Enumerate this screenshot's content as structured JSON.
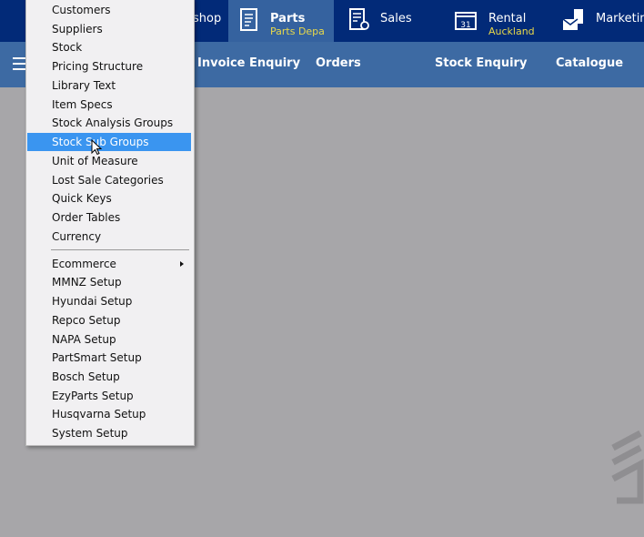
{
  "tabs": [
    {
      "label": "shop"
    },
    {
      "label": "Parts",
      "sub": "Parts Depa",
      "active": true
    },
    {
      "label": "Sales"
    },
    {
      "label": "Rental",
      "sub": "Auckland",
      "calendar_day": "31"
    },
    {
      "label": "Marketing"
    }
  ],
  "nav": [
    "Invoice Enquiry",
    "Orders",
    "Stock Enquiry",
    "Catalogue"
  ],
  "menu": {
    "items": [
      "Customers",
      "Suppliers",
      "Stock",
      "Pricing Structure",
      "Library Text",
      "Item Specs",
      "Stock Analysis Groups",
      "Stock Sub Groups",
      "Unit of Measure",
      "Lost Sale Categories",
      "Quick Keys",
      "Order Tables",
      "Currency"
    ],
    "items2": [
      "Ecommerce",
      "MMNZ Setup",
      "Hyundai Setup",
      "Repco Setup",
      "NAPA Setup",
      "PartSmart Setup",
      "Bosch Setup",
      "EzyParts Setup",
      "Husqvarna Setup",
      "System Setup"
    ],
    "highlighted": "Stock Sub Groups"
  },
  "colors": {
    "topbar": "#022a78",
    "navbar": "#3d6aa3",
    "highlight": "#3a95f0",
    "sub_text": "#e8d84a"
  }
}
